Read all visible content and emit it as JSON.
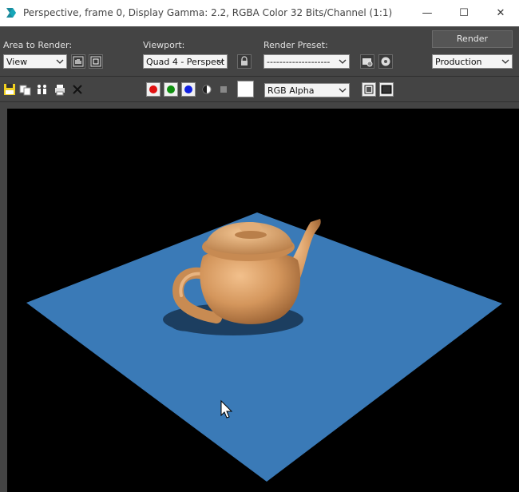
{
  "window": {
    "title": "Perspective, frame 0, Display Gamma: 2.2, RGBA Color 32 Bits/Channel (1:1)",
    "buttons": {
      "minimize": "—",
      "maximize": "☐",
      "close": "✕"
    }
  },
  "controls": {
    "area_label": "Area to Render:",
    "area_value": "View",
    "viewport_label": "Viewport:",
    "viewport_value": "Quad 4 - Perspect",
    "preset_label": "Render Preset:",
    "preset_value": "--------------------",
    "render_button": "Render",
    "mode_value": "Production"
  },
  "toolbar2": {
    "channel_value": "RGB Alpha",
    "channels": [
      {
        "name": "red",
        "color": "#e01010"
      },
      {
        "name": "green",
        "color": "#109010"
      },
      {
        "name": "blue",
        "color": "#1020e0"
      }
    ],
    "swatch_color": "#ffffff"
  },
  "scene": {
    "background": "#000000",
    "plane_color": "#3a7ab7",
    "teapot_color": "#d29660"
  },
  "icons": [
    "3dsmax-app-icon",
    "region-pan-icon",
    "region-select-icon",
    "lock-icon",
    "render-setup-icon",
    "environment-icon",
    "save-icon",
    "copy-icon",
    "clone-icon",
    "print-icon",
    "clear-icon",
    "mono-icon",
    "alpha-icon",
    "display-icon",
    "fit-icon",
    "cursor-icon"
  ]
}
